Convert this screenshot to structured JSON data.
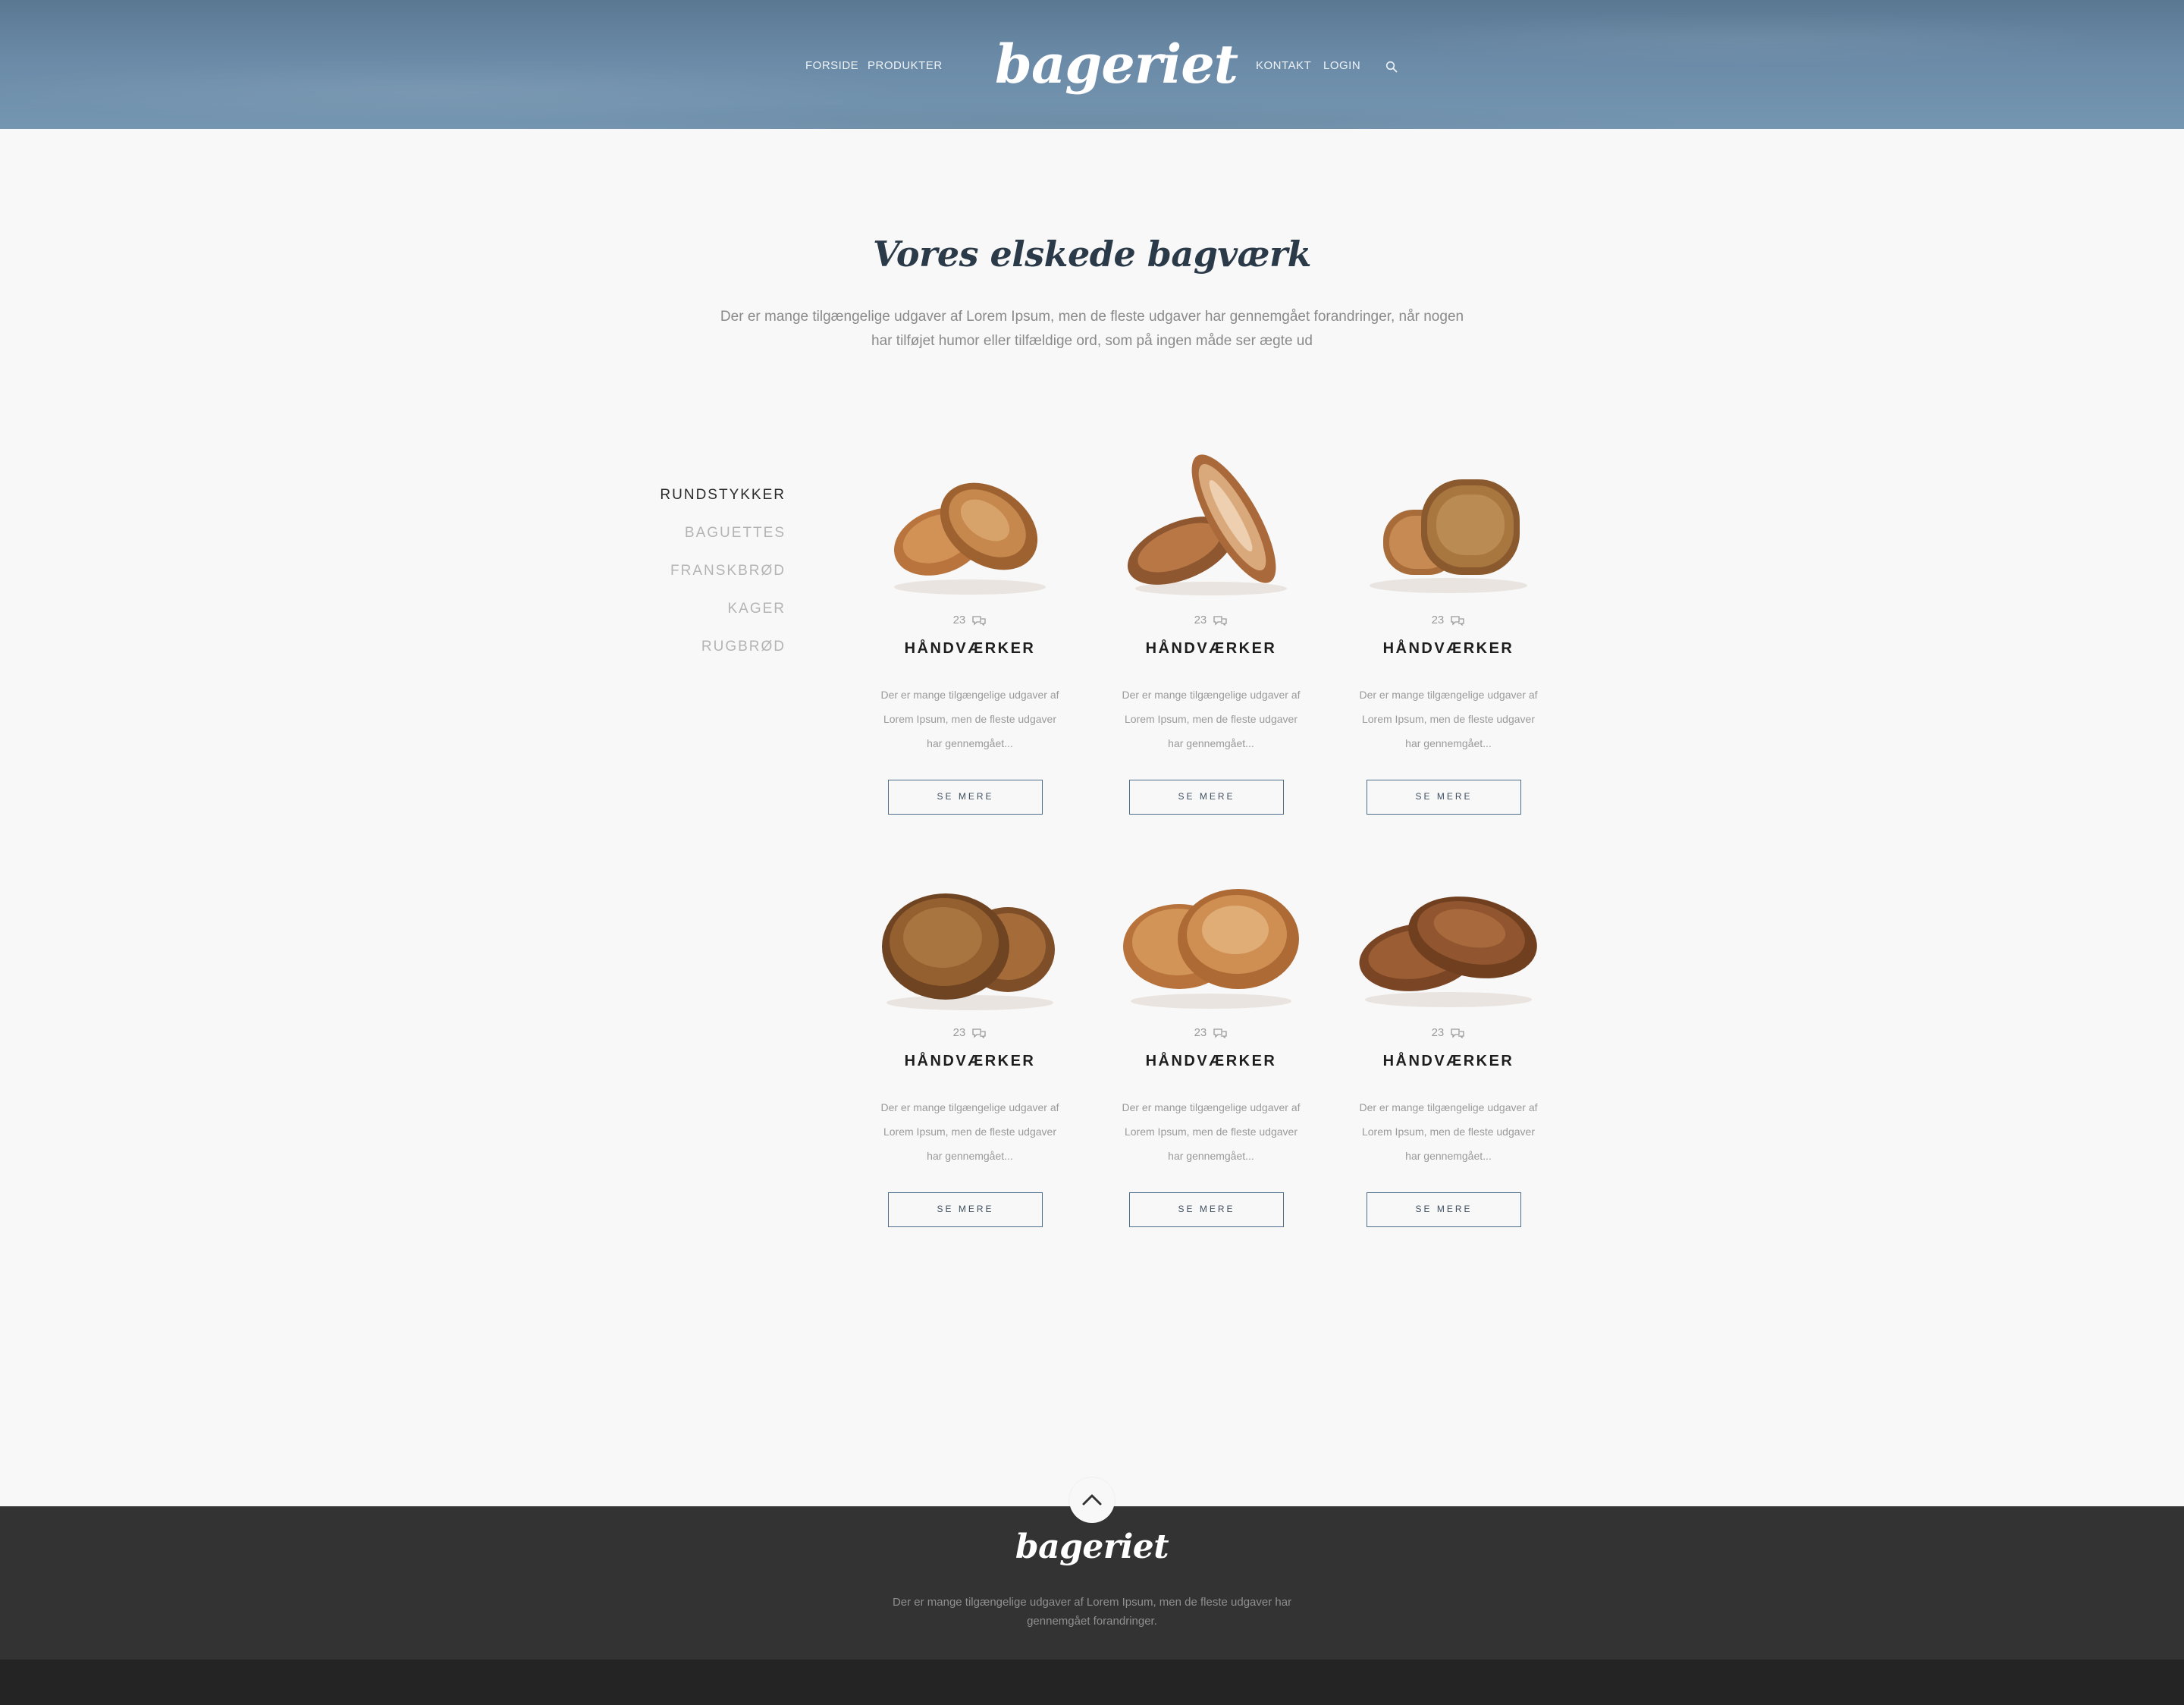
{
  "header": {
    "nav_left": [
      "FORSIDE",
      "PRODUKTER"
    ],
    "logo": "bageriet",
    "nav_right": [
      "KONTAKT",
      "LOGIN"
    ],
    "search_icon": "search-icon"
  },
  "intro": {
    "title": "Vores elskede bagværk",
    "lead": "Der er mange tilgængelige udgaver af Lorem Ipsum, men de fleste udgaver har gennemgået forandringer, når nogen har tilføjet humor eller tilfældige ord, som på ingen måde ser ægte ud"
  },
  "categories": [
    {
      "label": "RUNDSTYKKER",
      "active": true
    },
    {
      "label": "BAGUETTES",
      "active": false
    },
    {
      "label": "FRANSKBRØD",
      "active": false
    },
    {
      "label": "KAGER",
      "active": false
    },
    {
      "label": "RUGBRØD",
      "active": false
    }
  ],
  "products": [
    {
      "comments": "23",
      "comment_icon": "comment-icon",
      "name": "HÅNDVÆRKER",
      "desc": "Der er mange tilgængelige udgaver af Lorem Ipsum, men de fleste udgaver har gennemgået...",
      "button": "SE MERE"
    },
    {
      "comments": "23",
      "comment_icon": "comment-icon",
      "name": "HÅNDVÆRKER",
      "desc": "Der er mange tilgængelige udgaver af Lorem Ipsum, men de fleste udgaver har gennemgået...",
      "button": "SE MERE"
    },
    {
      "comments": "23",
      "comment_icon": "comment-icon",
      "name": "HÅNDVÆRKER",
      "desc": "Der er mange tilgængelige udgaver af Lorem Ipsum, men de fleste udgaver har gennemgået...",
      "button": "SE MERE"
    },
    {
      "comments": "23",
      "comment_icon": "comment-icon",
      "name": "HÅNDVÆRKER",
      "desc": "Der er mange tilgængelige udgaver af Lorem Ipsum, men de fleste udgaver har gennemgået...",
      "button": "SE MERE"
    },
    {
      "comments": "23",
      "comment_icon": "comment-icon",
      "name": "HÅNDVÆRKER",
      "desc": "Der er mange tilgængelige udgaver af Lorem Ipsum, men de fleste udgaver har gennemgået...",
      "button": "SE MERE"
    },
    {
      "comments": "23",
      "comment_icon": "comment-icon",
      "name": "HÅNDVÆRKER",
      "desc": "Der er mange tilgængelige udgaver af Lorem Ipsum, men de fleste udgaver har gennemgået...",
      "button": "SE MERE"
    }
  ],
  "footer": {
    "to_top_icon": "chevron-up-icon",
    "logo": "bageriet",
    "text": "Der er mange tilgængelige udgaver af Lorem Ipsum, men de fleste udgaver har gennemgået forandringer."
  },
  "colors": {
    "header_blue": "#6a8aa7",
    "title": "#2b3a48",
    "button_border": "#4e6e8e",
    "footer": "#333333",
    "footer_bottom": "#242424",
    "bread": "#b9763f"
  }
}
